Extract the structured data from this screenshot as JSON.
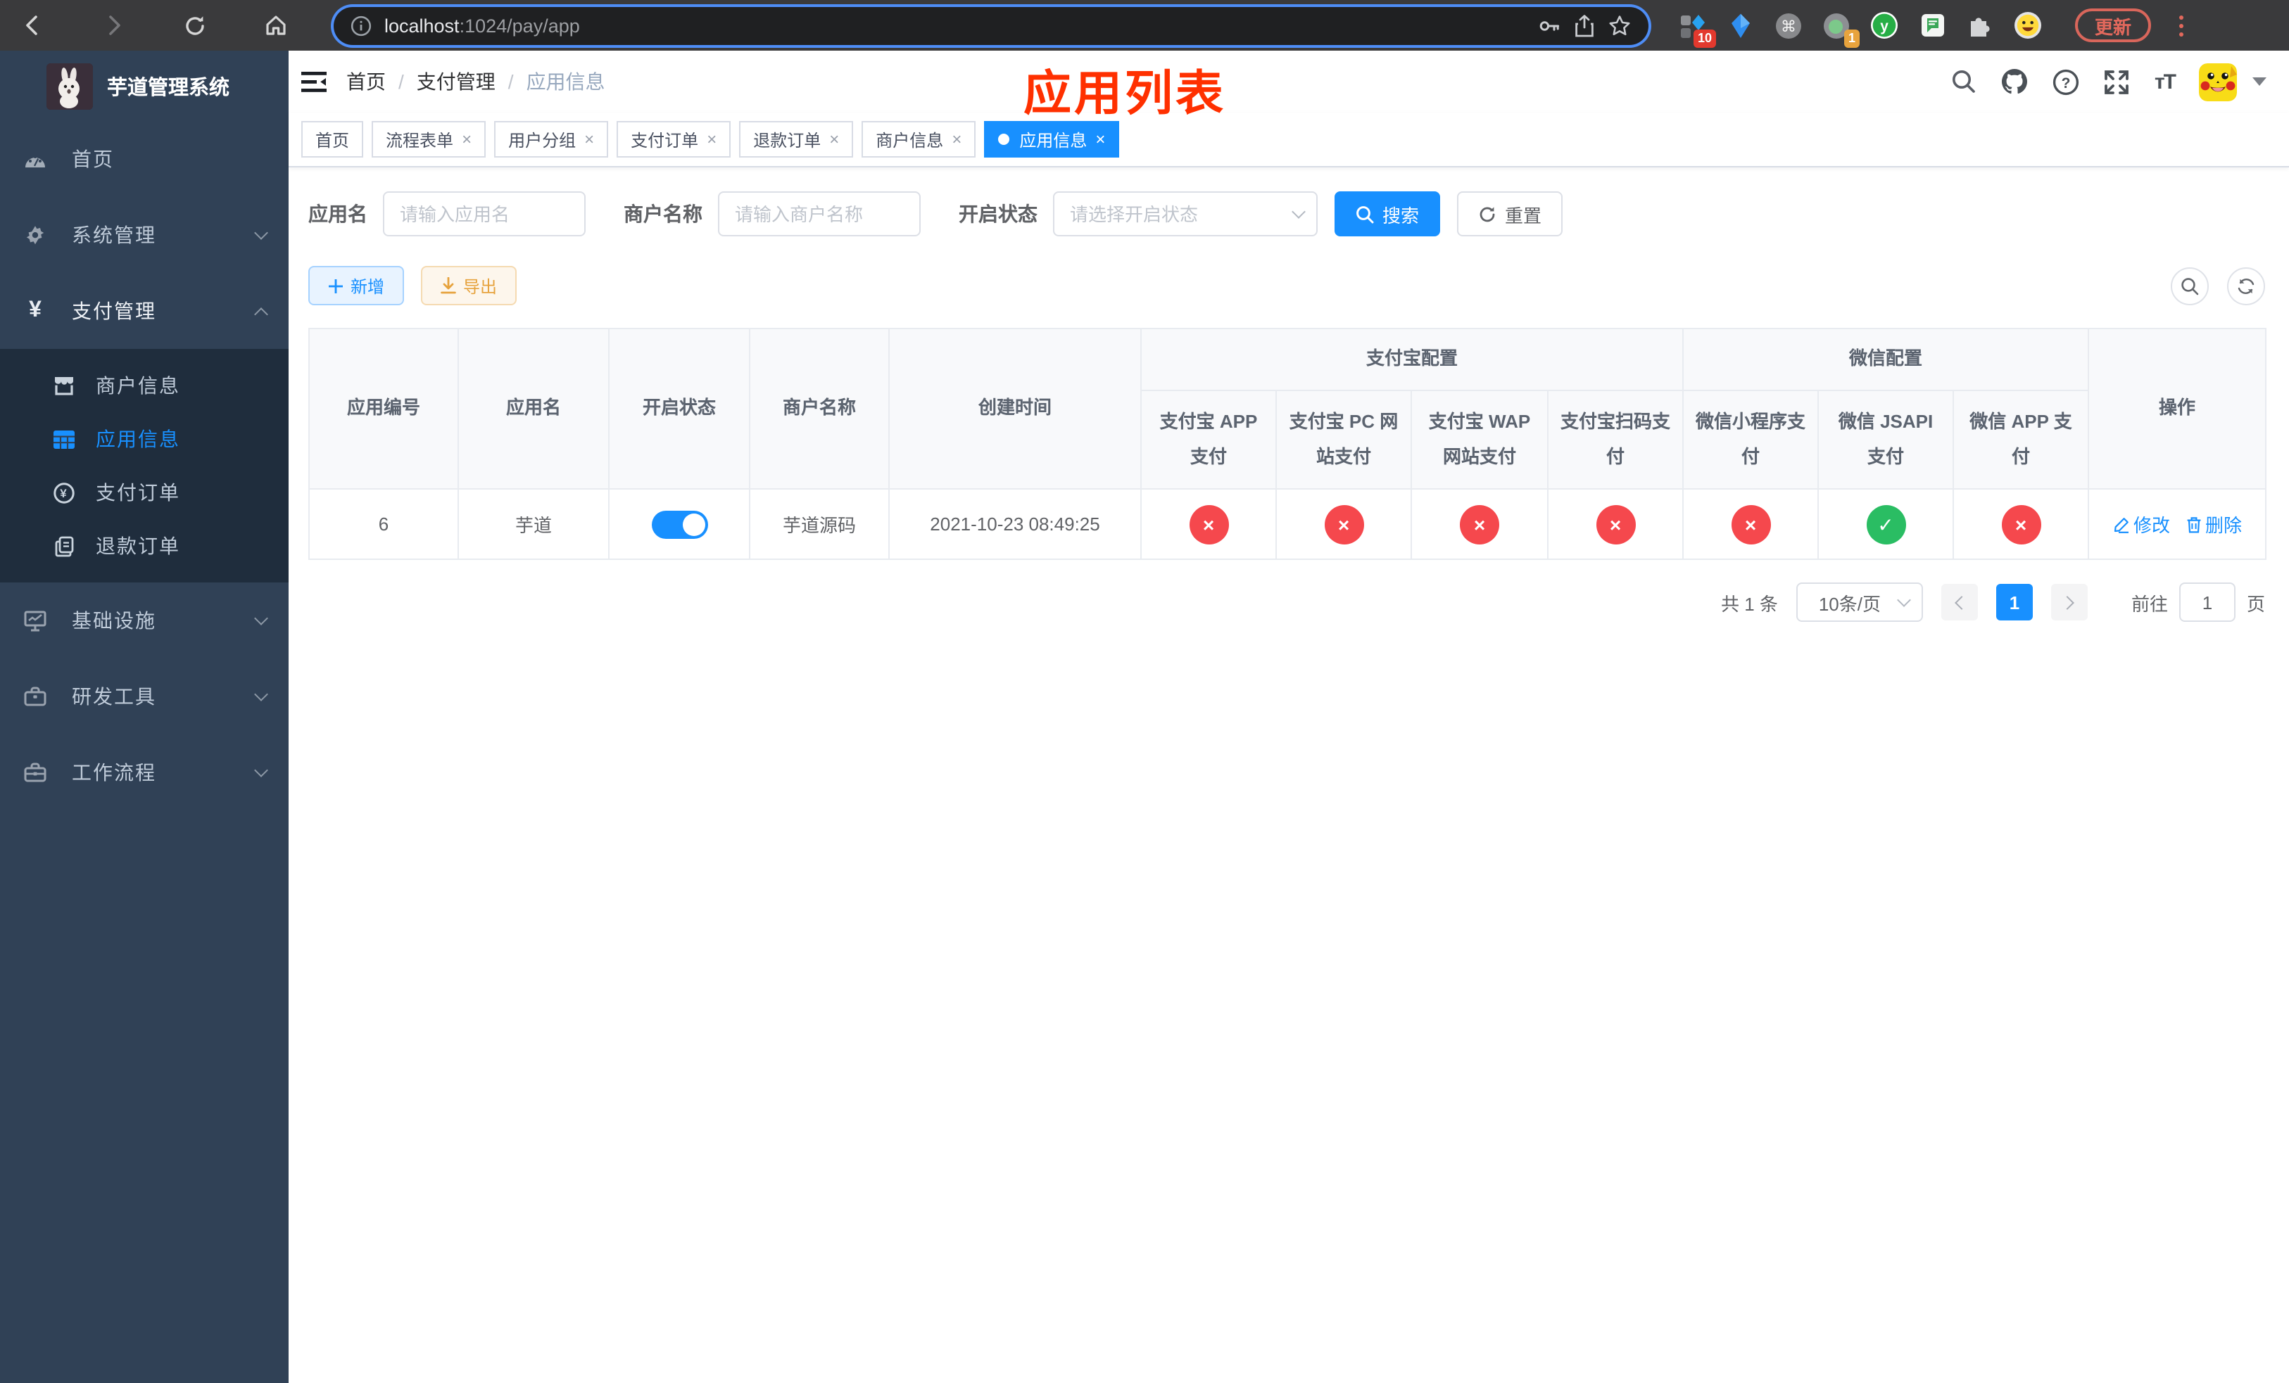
{
  "browser": {
    "url": {
      "host": "localhost",
      "path": ":1024/pay/app"
    },
    "update_label": "更新",
    "ext_badge_apps": "10",
    "ext_badge_proxy": "1"
  },
  "overlay_title": "应用列表",
  "sidebar": {
    "title": "芋道管理系统",
    "menu": [
      {
        "label": "首页"
      },
      {
        "label": "系统管理"
      },
      {
        "label": "支付管理"
      }
    ],
    "submenu": [
      {
        "label": "商户信息"
      },
      {
        "label": "应用信息"
      },
      {
        "label": "支付订单"
      },
      {
        "label": "退款订单"
      }
    ],
    "menu_bottom": [
      {
        "label": "基础设施"
      },
      {
        "label": "研发工具"
      },
      {
        "label": "工作流程"
      }
    ]
  },
  "breadcrumb": {
    "home": "首页",
    "section": "支付管理",
    "current": "应用信息"
  },
  "tabs": [
    {
      "label": "首页"
    },
    {
      "label": "流程表单"
    },
    {
      "label": "用户分组"
    },
    {
      "label": "支付订单"
    },
    {
      "label": "退款订单"
    },
    {
      "label": "商户信息"
    },
    {
      "label": "应用信息"
    }
  ],
  "filters": {
    "app_name_label": "应用名",
    "app_name_placeholder": "请输入应用名",
    "merchant_label": "商户名称",
    "merchant_placeholder": "请输入商户名称",
    "status_label": "开启状态",
    "status_placeholder": "请选择开启状态",
    "search_label": "搜索",
    "reset_label": "重置"
  },
  "toolbar": {
    "add_label": "新增",
    "export_label": "导出"
  },
  "table": {
    "headers": {
      "app_id": "应用编号",
      "app_name": "应用名",
      "status": "开启状态",
      "merchant": "商户名称",
      "created": "创建时间",
      "alipay_group": "支付宝配置",
      "wechat_group": "微信配置",
      "alipay_app": "支付宝 APP 支付",
      "alipay_pc": "支付宝 PC 网站支付",
      "alipay_wap": "支付宝 WAP 网站支付",
      "alipay_qr": "支付宝扫码支付",
      "wx_lite": "微信小程序支付",
      "wx_jsapi": "微信 JSAPI 支付",
      "wx_app": "微信 APP 支付",
      "actions": "操作"
    },
    "row": {
      "app_id": "6",
      "app_name": "芋道",
      "status_on": true,
      "merchant": "芋道源码",
      "created": "2021-10-23 08:49:25",
      "channels": [
        "x",
        "x",
        "x",
        "x",
        "x",
        "check",
        "x"
      ],
      "edit_label": "修改",
      "delete_label": "删除"
    }
  },
  "pagination": {
    "total": "共 1 条",
    "page_size": "10条/页",
    "current_page": "1",
    "goto_label": "前往",
    "goto_value": "1",
    "page_unit": "页"
  },
  "colors": {
    "accent": "#1890ff",
    "danger": "#f5484d",
    "success": "#2abd63",
    "title_red": "#ff3000"
  }
}
